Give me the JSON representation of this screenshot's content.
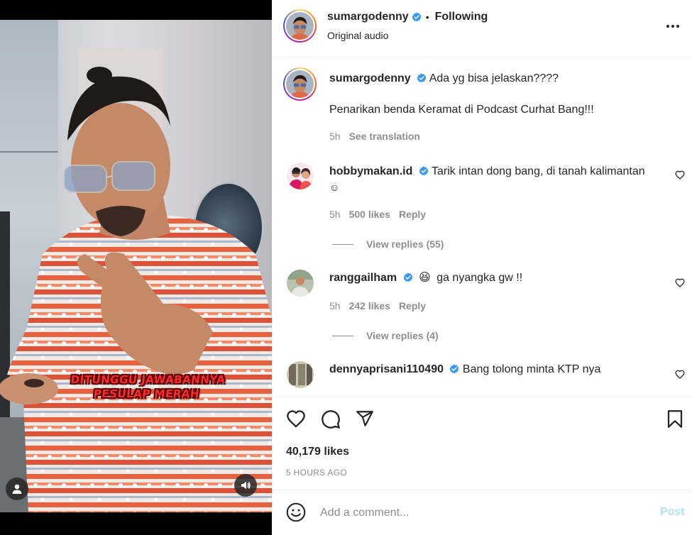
{
  "media": {
    "overlay_caption": "DITUNGGU JAWABANNYA PESULAP MERAH",
    "user_icon": "user-tag-icon",
    "audio_icon": "speaker-icon"
  },
  "header": {
    "username": "sumargodenny",
    "separator": "•",
    "follow_status": "Following",
    "subtitle": "Original audio",
    "more_icon": "more-dots-icon"
  },
  "caption": {
    "username": "sumargodenny",
    "line1": "Ada yg bisa jelaskan????",
    "line2": "Penarikan benda Keramat di Podcast Curhat Bang!!!",
    "time": "5h",
    "see_translation": "See translation"
  },
  "comments": [
    {
      "username": "hobbymakan.id",
      "text": "Tarik intan dong bang, di tanah kalimantan",
      "text2": "☺",
      "time": "5h",
      "likes": "500 likes",
      "reply": "Reply",
      "view_replies": "View replies (55)"
    },
    {
      "username": "ranggailham",
      "emoji": "😆",
      "text": "ga nyangka gw !!",
      "time": "5h",
      "likes": "242 likes",
      "reply": "Reply",
      "view_replies": "View replies (4)"
    },
    {
      "username": "dennyaprisani110490",
      "text": "Bang tolong minta KTP nya"
    }
  ],
  "actions": {
    "like_icon": "heart-icon",
    "comment_icon": "comment-icon",
    "share_icon": "send-icon",
    "save_icon": "bookmark-icon",
    "likes": "40,179 likes",
    "posted": "5 HOURS AGO"
  },
  "add_comment": {
    "placeholder": "Add a comment...",
    "post": "Post",
    "emoji_icon": "emoji-icon"
  },
  "colors": {
    "verified": "#3897f0",
    "muted": "#8e8e8e",
    "post_disabled": "#b2dffc",
    "caption_red": "#ff2a2a"
  }
}
